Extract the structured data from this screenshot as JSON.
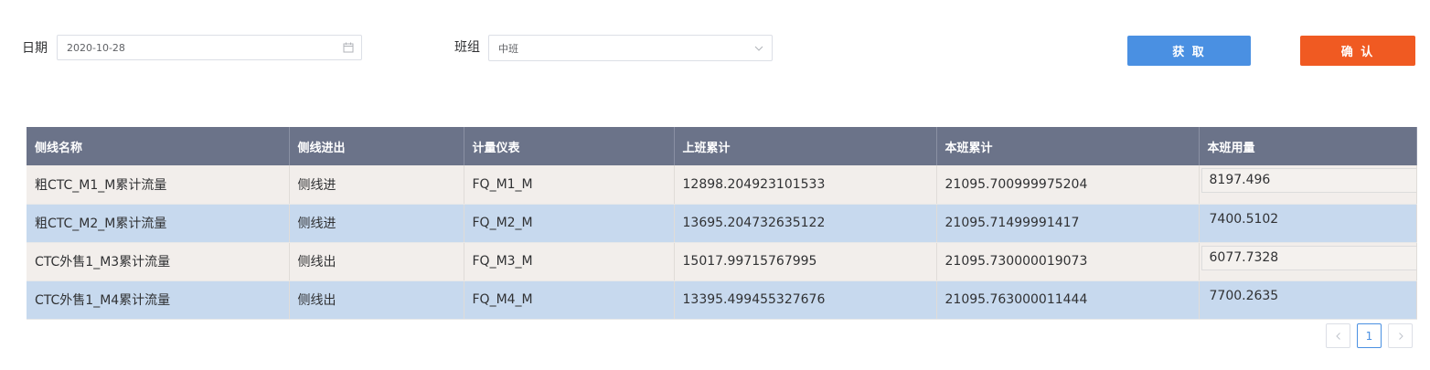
{
  "filters": {
    "date_label": "日期",
    "date_value": "2020-10-28",
    "shift_label": "班组",
    "shift_value": "中班"
  },
  "buttons": {
    "fetch": "获 取",
    "confirm": "确 认"
  },
  "colors": {
    "header_bg": "#6b7389",
    "row_odd_bg": "#f2eeeb",
    "row_even_bg": "#c7d9ee",
    "fetch_button": "#4a90e2",
    "confirm_button": "#f05a22"
  },
  "table": {
    "headers": [
      "侧线名称",
      "侧线进出",
      "计量仪表",
      "上班累计",
      "本班累计",
      "本班用量"
    ],
    "rows": [
      [
        "粗CTC_M1_M累计流量",
        "侧线进",
        "FQ_M1_M",
        "12898.204923101533",
        "21095.700999975204",
        "8197.496"
      ],
      [
        "粗CTC_M2_M累计流量",
        "侧线进",
        "FQ_M2_M",
        "13695.204732635122",
        "21095.71499991417",
        "7400.5102"
      ],
      [
        "CTC外售1_M3累计流量",
        "侧线出",
        "FQ_M3_M",
        "15017.99715767995",
        "21095.730000019073",
        "6077.7328"
      ],
      [
        "CTC外售1_M4累计流量",
        "侧线出",
        "FQ_M4_M",
        "13395.499455327676",
        "21095.763000011444",
        "7700.2635"
      ]
    ]
  },
  "pagination": {
    "prev_icon": "chevron-left-icon",
    "current_page": "1",
    "next_icon": "chevron-right-icon"
  }
}
